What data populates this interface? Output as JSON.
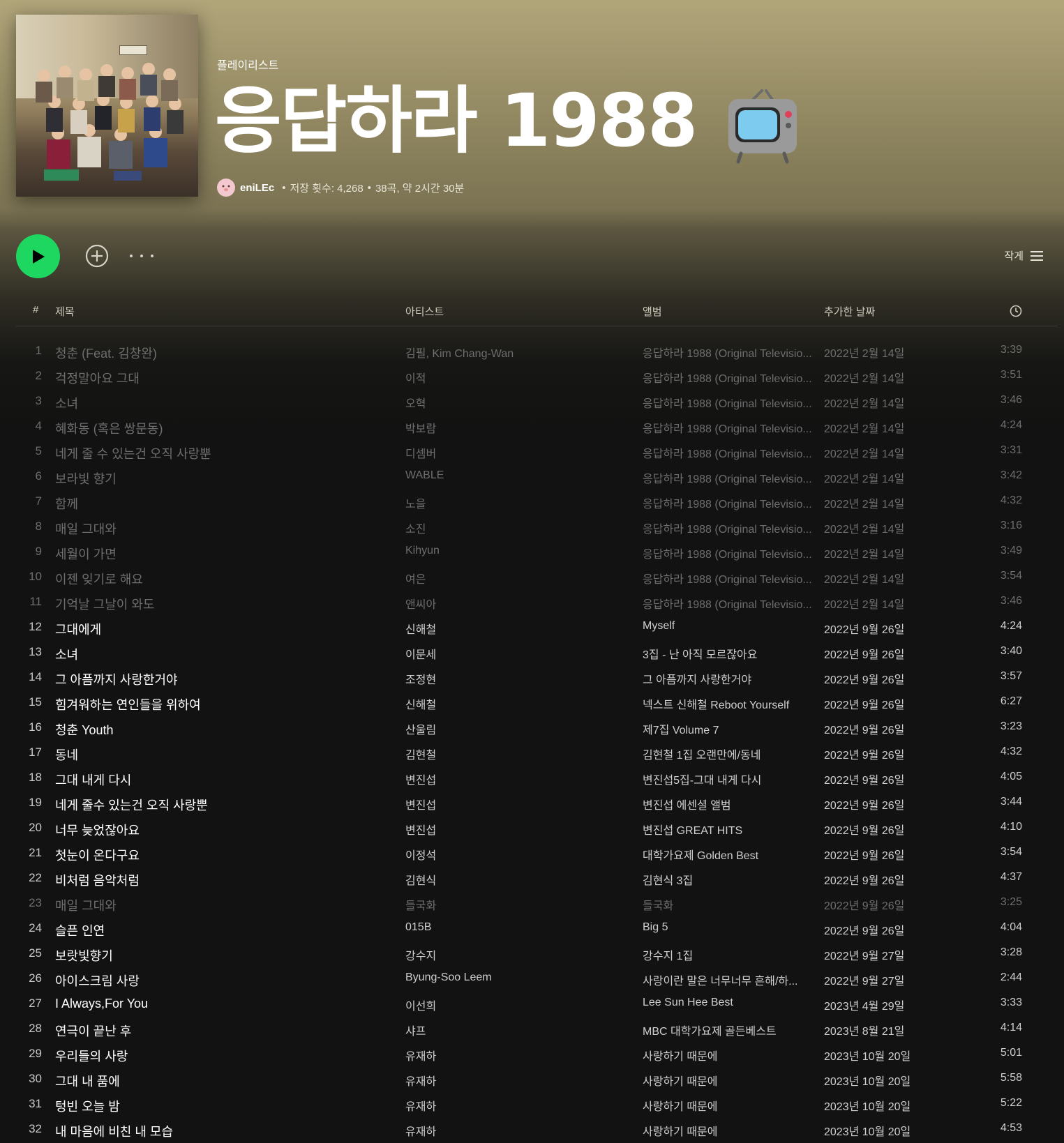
{
  "header": {
    "type_label": "플레이리스트",
    "title": "응답하라 1988",
    "title_emoji": "tv-icon",
    "owner": "eniLEc",
    "saves": "저장 횟수: 4,268",
    "summary": "38곡, 약 2시간 30분"
  },
  "actions": {
    "play_icon": "play-icon",
    "add_icon": "plus-circle-icon",
    "more_icon": "ellipsis-icon",
    "view_label": "작게",
    "view_icon": "list-icon"
  },
  "columns": {
    "num": "#",
    "title": "제목",
    "artist": "아티스트",
    "album": "앨범",
    "date": "추가한 날짜",
    "duration_icon": "clock-icon"
  },
  "colors": {
    "accent": "#1ed760",
    "header_bg": "#b1a57a",
    "page_bg": "#121212"
  },
  "tracks": [
    {
      "num": "1",
      "title": "청춘 (Feat. 김창완)",
      "artist": "김필, Kim Chang-Wan",
      "album": "응답하라 1988 (Original Televisio...",
      "date": "2022년 2월 14일",
      "duration": "3:39",
      "playable": false
    },
    {
      "num": "2",
      "title": "걱정말아요 그대",
      "artist": "이적",
      "album": "응답하라 1988 (Original Televisio...",
      "date": "2022년 2월 14일",
      "duration": "3:51",
      "playable": false
    },
    {
      "num": "3",
      "title": "소녀",
      "artist": "오혁",
      "album": "응답하라 1988 (Original Televisio...",
      "date": "2022년 2월 14일",
      "duration": "3:46",
      "playable": false
    },
    {
      "num": "4",
      "title": "혜화동 (혹은 쌍문동)",
      "artist": "박보람",
      "album": "응답하라 1988 (Original Televisio...",
      "date": "2022년 2월 14일",
      "duration": "4:24",
      "playable": false
    },
    {
      "num": "5",
      "title": "네게 줄 수 있는건 오직 사랑뿐",
      "artist": "디셈버",
      "album": "응답하라 1988 (Original Televisio...",
      "date": "2022년 2월 14일",
      "duration": "3:31",
      "playable": false
    },
    {
      "num": "6",
      "title": "보라빛 향기",
      "artist": "WABLE",
      "album": "응답하라 1988 (Original Televisio...",
      "date": "2022년 2월 14일",
      "duration": "3:42",
      "playable": false
    },
    {
      "num": "7",
      "title": "함께",
      "artist": "노을",
      "album": "응답하라 1988 (Original Televisio...",
      "date": "2022년 2월 14일",
      "duration": "4:32",
      "playable": false
    },
    {
      "num": "8",
      "title": "매일 그대와",
      "artist": "소진",
      "album": "응답하라 1988 (Original Televisio...",
      "date": "2022년 2월 14일",
      "duration": "3:16",
      "playable": false
    },
    {
      "num": "9",
      "title": "세월이 가면",
      "artist": "Kihyun",
      "album": "응답하라 1988 (Original Televisio...",
      "date": "2022년 2월 14일",
      "duration": "3:49",
      "playable": false
    },
    {
      "num": "10",
      "title": "이젠 잊기로 해요",
      "artist": "여은",
      "album": "응답하라 1988 (Original Televisio...",
      "date": "2022년 2월 14일",
      "duration": "3:54",
      "playable": false
    },
    {
      "num": "11",
      "title": "기억날 그날이 와도",
      "artist": "앤씨아",
      "album": "응답하라 1988 (Original Televisio...",
      "date": "2022년 2월 14일",
      "duration": "3:46",
      "playable": false
    },
    {
      "num": "12",
      "title": "그대에게",
      "artist": "신해철",
      "album": "Myself",
      "date": "2022년 9월 26일",
      "duration": "4:24",
      "playable": true
    },
    {
      "num": "13",
      "title": "소녀",
      "artist": "이문세",
      "album": "3집 - 난 아직 모르잖아요",
      "date": "2022년 9월 26일",
      "duration": "3:40",
      "playable": true
    },
    {
      "num": "14",
      "title": "그 아픔까지 사랑한거야",
      "artist": "조정현",
      "album": "그 아픔까지 사랑한거야",
      "date": "2022년 9월 26일",
      "duration": "3:57",
      "playable": true
    },
    {
      "num": "15",
      "title": "힘겨워하는 연인들을 위하여",
      "artist": "신해철",
      "album": "넥스트 신해철 Reboot Yourself",
      "date": "2022년 9월 26일",
      "duration": "6:27",
      "playable": true
    },
    {
      "num": "16",
      "title": "청춘 Youth",
      "artist": "산울림",
      "album": "제7집 Volume 7",
      "date": "2022년 9월 26일",
      "duration": "3:23",
      "playable": true
    },
    {
      "num": "17",
      "title": "동네",
      "artist": "김현철",
      "album": "김현철 1집 오랜만에/동네",
      "date": "2022년 9월 26일",
      "duration": "4:32",
      "playable": true
    },
    {
      "num": "18",
      "title": "그대 내게 다시",
      "artist": "변진섭",
      "album": "변진섭5집-그대 내게 다시",
      "date": "2022년 9월 26일",
      "duration": "4:05",
      "playable": true
    },
    {
      "num": "19",
      "title": "네게 줄수 있는건 오직 사랑뿐",
      "artist": "변진섭",
      "album": "변진섭 에센셜 앨범",
      "date": "2022년 9월 26일",
      "duration": "3:44",
      "playable": true
    },
    {
      "num": "20",
      "title": "너무 늦었잖아요",
      "artist": "변진섭",
      "album": "변진섭 GREAT HITS",
      "date": "2022년 9월 26일",
      "duration": "4:10",
      "playable": true
    },
    {
      "num": "21",
      "title": "첫눈이 온다구요",
      "artist": "이정석",
      "album": "대학가요제 Golden Best",
      "date": "2022년 9월 26일",
      "duration": "3:54",
      "playable": true
    },
    {
      "num": "22",
      "title": "비처럼 음악처럼",
      "artist": "김현식",
      "album": "김현식 3집",
      "date": "2022년 9월 26일",
      "duration": "4:37",
      "playable": true
    },
    {
      "num": "23",
      "title": "매일 그대와",
      "artist": "들국화",
      "album": "들국화",
      "date": "2022년 9월 26일",
      "duration": "3:25",
      "playable": false
    },
    {
      "num": "24",
      "title": "슬픈 인연",
      "artist": "015B",
      "album": "Big 5",
      "date": "2022년 9월 26일",
      "duration": "4:04",
      "playable": true
    },
    {
      "num": "25",
      "title": "보랏빛향기",
      "artist": "강수지",
      "album": "강수지 1집",
      "date": "2022년 9월 27일",
      "duration": "3:28",
      "playable": true
    },
    {
      "num": "26",
      "title": "아이스크림 사랑",
      "artist": "Byung-Soo Leem",
      "album": "사랑이란 말은 너무너무 흔해/하...",
      "date": "2022년 9월 27일",
      "duration": "2:44",
      "playable": true
    },
    {
      "num": "27",
      "title": "I Always,For You",
      "artist": "이선희",
      "album": "Lee Sun Hee Best",
      "date": "2023년 4월 29일",
      "duration": "3:33",
      "playable": true
    },
    {
      "num": "28",
      "title": "연극이 끝난 후",
      "artist": "샤프",
      "album": "MBC 대학가요제 골든베스트",
      "date": "2023년 8월 21일",
      "duration": "4:14",
      "playable": true
    },
    {
      "num": "29",
      "title": "우리들의 사랑",
      "artist": "유재하",
      "album": "사랑하기 때문에",
      "date": "2023년 10월 20일",
      "duration": "5:01",
      "playable": true
    },
    {
      "num": "30",
      "title": "그대 내 품에",
      "artist": "유재하",
      "album": "사랑하기 때문에",
      "date": "2023년 10월 20일",
      "duration": "5:58",
      "playable": true
    },
    {
      "num": "31",
      "title": "텅빈 오늘 밤",
      "artist": "유재하",
      "album": "사랑하기 때문에",
      "date": "2023년 10월 20일",
      "duration": "5:22",
      "playable": true
    },
    {
      "num": "32",
      "title": "내 마음에 비친 내 모습",
      "artist": "유재하",
      "album": "사랑하기 때문에",
      "date": "2023년 10월 20일",
      "duration": "4:53",
      "playable": true
    }
  ]
}
